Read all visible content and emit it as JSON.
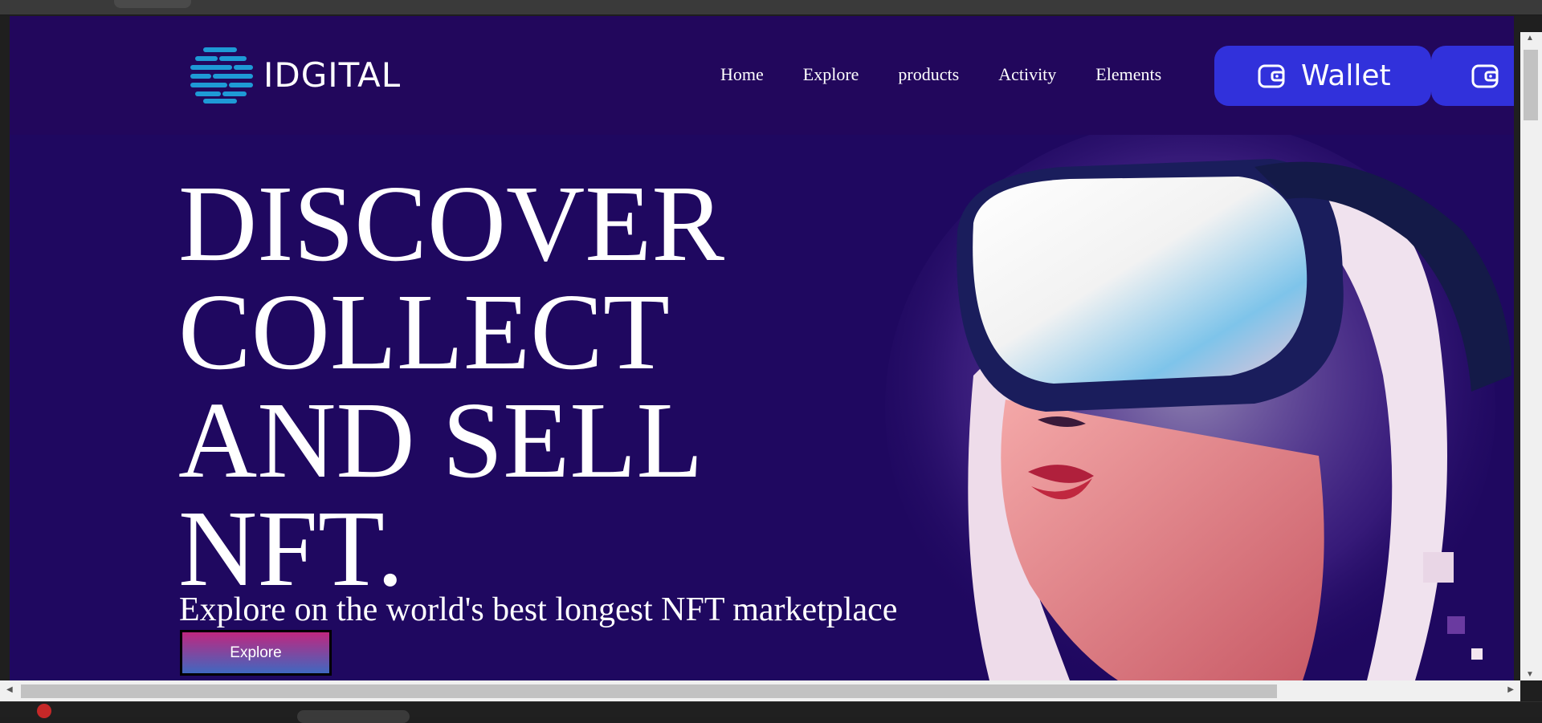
{
  "brand": {
    "name": "IDGITAL",
    "logo_color": "#1e9ad6"
  },
  "nav": {
    "links": [
      "Home",
      "Explore",
      "products",
      "Activity",
      "Elements"
    ],
    "wallet_label": "Wallet",
    "wallet_icon": "wallet-icon",
    "wallet_color": "#3131db"
  },
  "hero": {
    "headline_lines": [
      "DISCOVER",
      "COLLECT",
      "AND SELL",
      "NFT."
    ],
    "subline": "Explore on the world's best longest NFT marketplace",
    "cta_label": "Explore",
    "background_color": "#1f0860",
    "illustration": "vr-headset-woman-illustration"
  }
}
